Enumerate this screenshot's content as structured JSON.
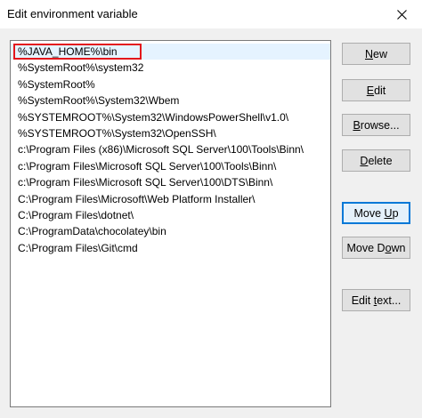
{
  "window": {
    "title": "Edit environment variable",
    "close_icon": "close-x-icon"
  },
  "path_list": {
    "selected_index": 0,
    "items": [
      "%JAVA_HOME%\\bin",
      "%SystemRoot%\\system32",
      "%SystemRoot%",
      "%SystemRoot%\\System32\\Wbem",
      "%SYSTEMROOT%\\System32\\WindowsPowerShell\\v1.0\\",
      "%SYSTEMROOT%\\System32\\OpenSSH\\",
      "c:\\Program Files (x86)\\Microsoft SQL Server\\100\\Tools\\Binn\\",
      "c:\\Program Files\\Microsoft SQL Server\\100\\Tools\\Binn\\",
      "c:\\Program Files\\Microsoft SQL Server\\100\\DTS\\Binn\\",
      "C:\\Program Files\\Microsoft\\Web Platform Installer\\",
      "C:\\Program Files\\dotnet\\",
      "C:\\ProgramData\\chocolatey\\bin",
      "C:\\Program Files\\Git\\cmd"
    ]
  },
  "buttons": {
    "new": {
      "mnemonic": "N",
      "rest": "ew"
    },
    "edit": {
      "mnemonic": "E",
      "rest": "dit"
    },
    "browse": {
      "pre": "",
      "mnemonic": "B",
      "rest": "rowse..."
    },
    "delete": {
      "mnemonic": "D",
      "rest": "elete"
    },
    "move_up": {
      "pre": "Move ",
      "mnemonic": "U",
      "rest": "p"
    },
    "move_down": {
      "pre": "Move D",
      "mnemonic": "o",
      "rest": "wn"
    },
    "edit_text": {
      "pre": "Edit ",
      "mnemonic": "t",
      "rest": "ext..."
    }
  }
}
